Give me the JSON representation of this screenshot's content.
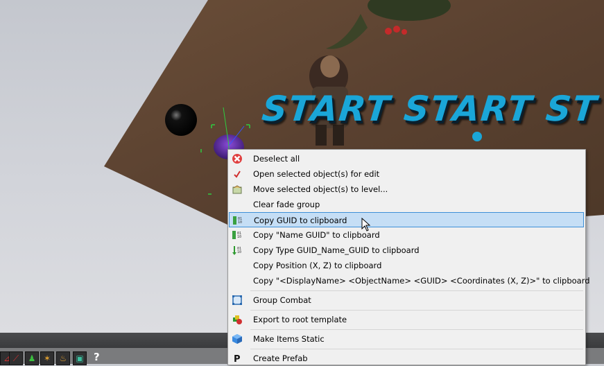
{
  "scene": {
    "banner_text": "START START ST"
  },
  "context_menu": {
    "items": [
      {
        "label": "Deselect all",
        "icon": "red-x-icon"
      },
      {
        "label": "Open selected object(s) for edit",
        "icon": "checkmark-icon"
      },
      {
        "label": "Move selected object(s) to level...",
        "icon": "move-to-level-icon"
      },
      {
        "label": "Clear fade group",
        "icon": ""
      },
      {
        "label": "Copy GUID to clipboard",
        "icon": "guid-icon",
        "highlighted": true
      },
      {
        "label": "Copy \"Name GUID\" to clipboard",
        "icon": "guid-icon"
      },
      {
        "label": "Copy Type GUID_Name_GUID to clipboard",
        "icon": "guid-green-icon"
      },
      {
        "label": "Copy Position (X, Z) to clipboard",
        "icon": ""
      },
      {
        "label": "Copy \"<DisplayName> <ObjectName> <GUID> <Coordinates (X, Z)>\" to clipboard",
        "icon": ""
      },
      {
        "label": "Group Combat",
        "icon": "group-frame-icon"
      },
      {
        "label": "Export to root template",
        "icon": "export-template-icon"
      },
      {
        "label": "Make Items Static",
        "icon": "blue-cube-icon"
      },
      {
        "label": "Create Prefab",
        "icon": "prefab-p-icon"
      }
    ]
  },
  "toolbar": {
    "help_label": "?"
  },
  "colors": {
    "menu_bg": "#f0f0f0",
    "highlight_bg": "#c5def5",
    "highlight_border": "#3d8fd8",
    "banner_text": "#1aa6d8"
  }
}
